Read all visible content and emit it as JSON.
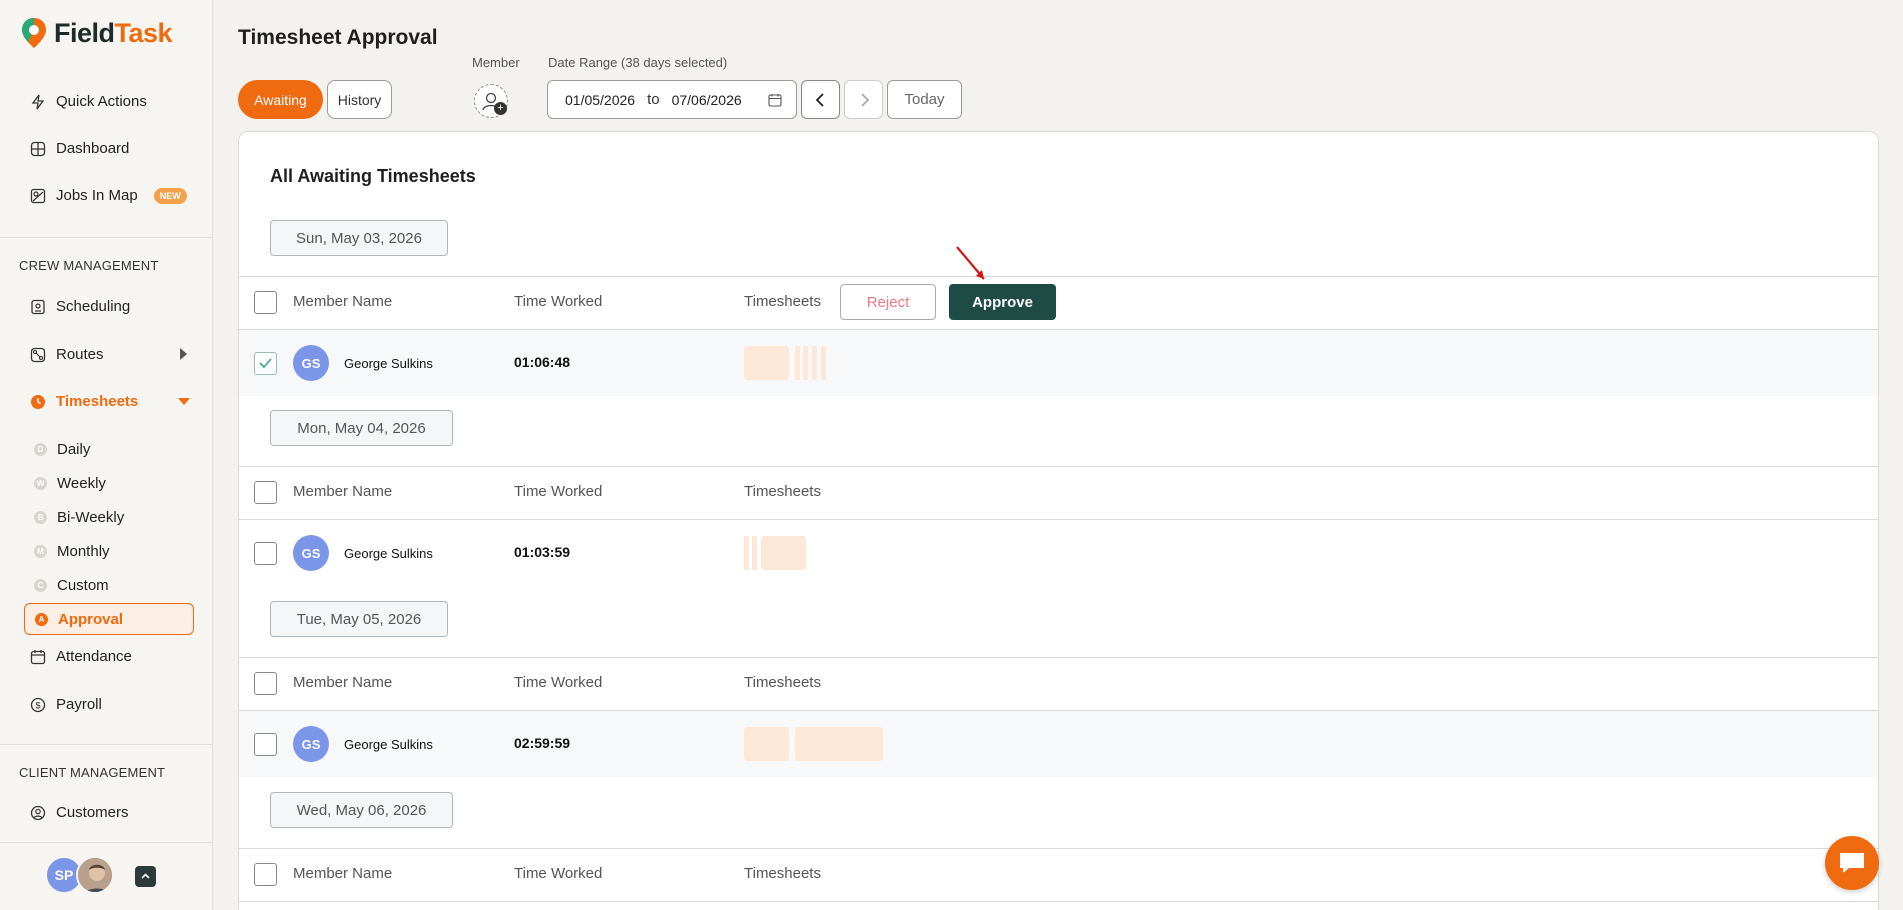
{
  "app": {
    "logo_part1": "Field",
    "logo_part2": "Task",
    "brand_color": "#f06a0f",
    "accent_color": "#1f4b45"
  },
  "sidebar": {
    "top_items": [
      {
        "label": "Quick Actions",
        "icon": "lightning-icon"
      },
      {
        "label": "Dashboard",
        "icon": "dashboard-icon"
      },
      {
        "label": "Jobs In Map",
        "icon": "map-icon",
        "badge": "NEW"
      }
    ],
    "crew_section": "CREW MANAGEMENT",
    "crew_items": [
      {
        "label": "Scheduling",
        "icon": "scheduling-icon"
      },
      {
        "label": "Routes",
        "icon": "routes-icon"
      },
      {
        "label": "Timesheets",
        "icon": "clock-icon"
      }
    ],
    "timesheet_sub": [
      {
        "label": "Daily",
        "letter": "D"
      },
      {
        "label": "Weekly",
        "letter": "W"
      },
      {
        "label": "Bi-Weekly",
        "letter": "B"
      },
      {
        "label": "Monthly",
        "letter": "M"
      },
      {
        "label": "Custom",
        "letter": "C"
      },
      {
        "label": "Approval",
        "letter": "A"
      }
    ],
    "more_items": [
      {
        "label": "Attendance",
        "icon": "calendar-icon"
      },
      {
        "label": "Payroll",
        "icon": "payroll-icon"
      }
    ],
    "client_section": "CLIENT MANAGEMENT",
    "client_items": [
      {
        "label": "Customers",
        "icon": "customers-icon"
      }
    ],
    "user_initials": "SP"
  },
  "header": {
    "title": "Timesheet Approval",
    "tab_awaiting": "Awaiting",
    "tab_history": "History",
    "member_label": "Member",
    "date_range_label": "Date Range (38 days selected)",
    "date_from": "01/05/2026",
    "date_to_word": "to",
    "date_to": "07/06/2026",
    "today": "Today"
  },
  "panel": {
    "title": "All Awaiting Timesheets",
    "col_member": "Member Name",
    "col_time": "Time Worked",
    "col_timesheets": "Timesheets",
    "reject": "Reject",
    "approve": "Approve",
    "groups": [
      {
        "date": "Sun, May 03, 2026",
        "initials": "GS",
        "name": "George Sulkins",
        "time": "01:06:48",
        "checked": true
      },
      {
        "date": "Mon, May 04, 2026",
        "initials": "GS",
        "name": "George Sulkins",
        "time": "01:03:59",
        "checked": false
      },
      {
        "date": "Tue, May 05, 2026",
        "initials": "GS",
        "name": "George Sulkins",
        "time": "02:59:59",
        "checked": false
      },
      {
        "date": "Wed, May 06, 2026"
      }
    ]
  }
}
